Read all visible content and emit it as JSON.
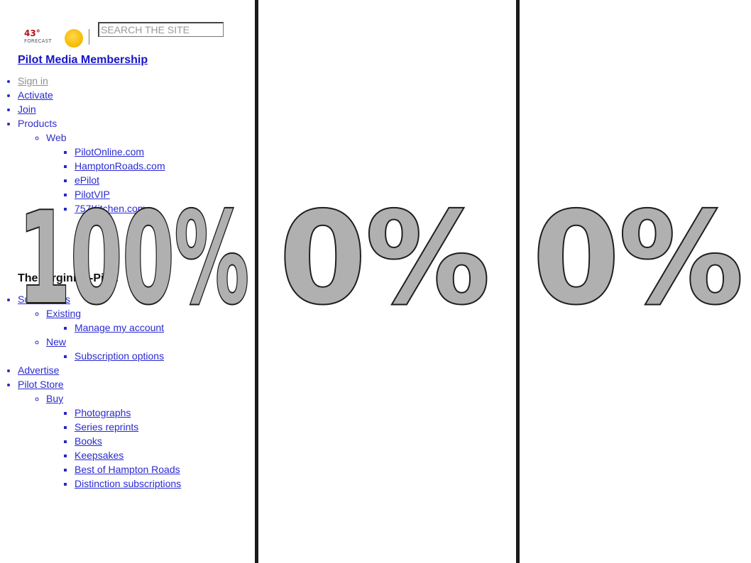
{
  "weather": {
    "temperature": "43°",
    "label": "FORECAST",
    "icon": "sun-icon"
  },
  "search": {
    "placeholder": "SEARCH THE SITE"
  },
  "membership": {
    "title": "Pilot Media Membership",
    "items": [
      {
        "label": "Sign in"
      },
      {
        "label": "Activate"
      },
      {
        "label": "Join"
      },
      {
        "label": "Products",
        "web": {
          "label": "Web",
          "items": [
            "PilotOnline.com",
            "HamptonRoads.com",
            "ePilot",
            "PilotVIP",
            "757Kitchen.com"
          ]
        }
      }
    ]
  },
  "virginian_pilot": {
    "title": "The Virginian-Pilot",
    "subscribers": {
      "label": "Subscribers",
      "existing": {
        "label": "Existing",
        "item": "Manage my account"
      },
      "new": {
        "label": "New",
        "item": "Subscription options"
      }
    },
    "advertise": "Advertise",
    "store": {
      "label": "Pilot Store",
      "buy": {
        "label": "Buy",
        "items": [
          "Photographs",
          "Series reprints",
          "Books",
          "Keepsakes",
          "Best of Hampton Roads",
          "Distinction subscriptions"
        ]
      }
    }
  },
  "progress": {
    "columns": [
      {
        "text": "100%",
        "value": 100
      },
      {
        "text": "0%",
        "value": 0
      },
      {
        "text": "0%",
        "value": 0
      }
    ],
    "fill_color": "#b0b0b0",
    "outline_color": "#1e1e1e"
  }
}
